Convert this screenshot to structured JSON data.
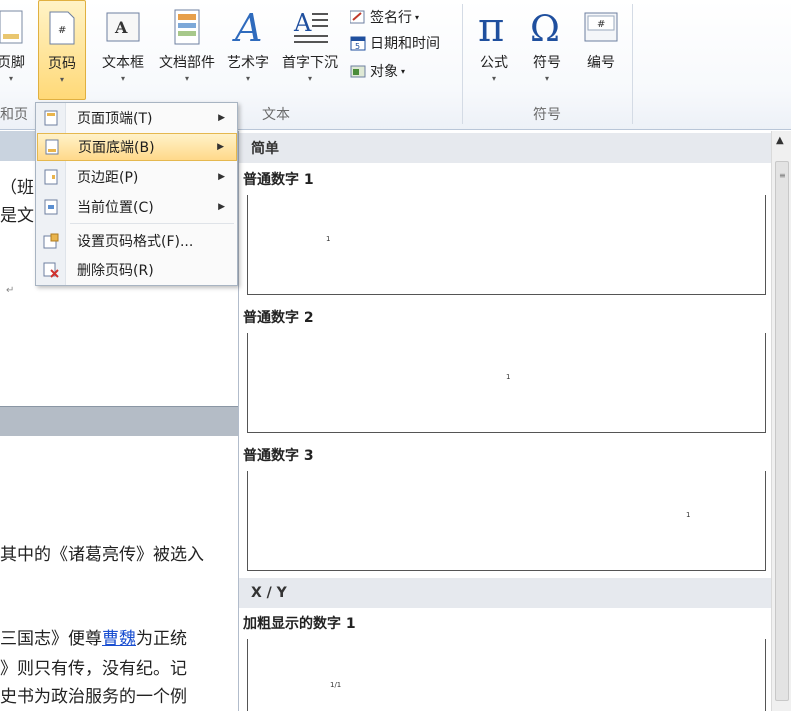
{
  "ribbon": {
    "buttons": {
      "footer": "页脚",
      "page_number": "页码",
      "text_box": "文本框",
      "quick_parts": "文档部件",
      "wordart": "艺术字",
      "drop_cap": "首字下沉",
      "equation": "公式",
      "symbol": "符号",
      "number": "编号"
    },
    "small_buttons": {
      "signature_line": "签名行",
      "date_time": "日期和时间",
      "object": "对象"
    },
    "groups": {
      "header_footer": "和页",
      "text": "文本",
      "symbols": "符号"
    }
  },
  "menu": {
    "items": [
      {
        "label": "页面顶端(T)",
        "has_submenu": true
      },
      {
        "label": "页面底端(B)",
        "has_submenu": true,
        "highlighted": true
      },
      {
        "label": "页边距(P)",
        "has_submenu": true
      },
      {
        "label": "当前位置(C)",
        "has_submenu": true
      },
      {
        "label": "设置页码格式(F)...",
        "has_submenu": false
      },
      {
        "label": "删除页码(R)",
        "has_submenu": false
      }
    ]
  },
  "gallery": {
    "section_simple": "简单",
    "item1": "普通数字 1",
    "item2": "普通数字 2",
    "item3": "普通数字 3",
    "section_xy": "X / Y",
    "item4": "加粗显示的数字 1",
    "thumb1_num": "1",
    "thumb2_num": "1",
    "thumb3_num": "1",
    "thumb4_num": "1/1"
  },
  "document": {
    "line1": "（班",
    "line2": "是文",
    "line3": "其中的《诸葛亮传》被选入",
    "line4_pre": "三国志》便尊",
    "line4_link": "曹魏",
    "line4_post": "为正统",
    "line5": "》则只有传，没有纪。记",
    "line6": "史书为政治服务的一个例"
  },
  "colors": {
    "accent_highlight": "#ffd98a",
    "link": "#1a4fd1",
    "ribbon_blue": "#1f4f9e"
  }
}
